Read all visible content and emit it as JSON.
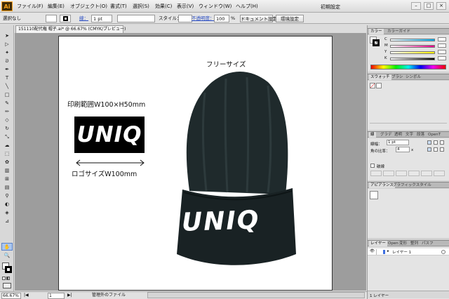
{
  "app": {
    "logo": "Ai"
  },
  "menu": [
    "ファイル(F)",
    "編集(E)",
    "オブジェクト(O)",
    "書式(T)",
    "選択(S)",
    "効果(C)",
    "表示(V)",
    "ウィンドウ(W)",
    "ヘルプ(H)"
  ],
  "workspace": "初期設定",
  "window_controls": [
    "–",
    "□",
    "×"
  ],
  "control": {
    "selection": "選択なし",
    "stroke_label": "線：",
    "stroke_value": "1 pt",
    "style_label": "スタイル：",
    "opacity_label": "不透明度：",
    "opacity_value": "100",
    "opacity_unit": "%",
    "doc_setup": "ドキュメント設定",
    "prefs": "環境設定"
  },
  "doc_tab": "151110配代権 帽子.ai* @ 66.67% (CMYK/プレビュー)",
  "artboard": {
    "size_label": "フリーサイズ",
    "print_area": "印刷範囲W100×H50mm",
    "logo_text": "UNIQ",
    "logo_width": "ロゴサイズW100mm",
    "beanie_logo": "UNIQ"
  },
  "status": {
    "zoom": "66.67%",
    "page": "1",
    "info": "管理外のファイル"
  },
  "panels": {
    "color": {
      "tabs": [
        "カラー",
        "カラーガイド"
      ],
      "channels": [
        "C",
        "M",
        "Y",
        "K"
      ]
    },
    "swatch": {
      "tabs": [
        "スウォッチ",
        "ブラシ",
        "シンボル"
      ]
    },
    "stroke": {
      "tabs": [
        "線",
        "グラデ",
        "透明",
        "文字",
        "段落",
        "OpenT"
      ],
      "width_label": "線幅：",
      "width_value": "1 pt",
      "miter_label": "角の比率：",
      "miter_value": "4",
      "miter_unit": "x",
      "dash_label": "破線"
    },
    "appearance": {
      "tabs": [
        "アピアランス",
        "グラフィックスタイル"
      ]
    },
    "layers": {
      "tabs": [
        "レイヤー",
        "Open",
        "変形",
        "整列",
        "パスフ"
      ],
      "layer_name": "レイヤー 1",
      "footer": "1 レイヤー"
    }
  },
  "colors": {
    "accent": "#f7a21b",
    "beanie": "#1c2527",
    "selection": "#aac7f0"
  },
  "icons": [
    "selection-arrow-icon",
    "direct-selection-icon",
    "magic-wand-icon",
    "lasso-icon",
    "pen-icon",
    "type-icon",
    "line-icon",
    "rectangle-icon",
    "paintbrush-icon",
    "pencil-icon",
    "eraser-icon",
    "rotate-icon",
    "scale-icon",
    "warp-icon",
    "free-transform-icon",
    "symbol-sprayer-icon",
    "graph-icon",
    "mesh-icon",
    "gradient-icon",
    "eyedropper-icon",
    "blend-icon",
    "live-paint-icon",
    "slice-icon",
    "hand-icon",
    "zoom-icon"
  ]
}
